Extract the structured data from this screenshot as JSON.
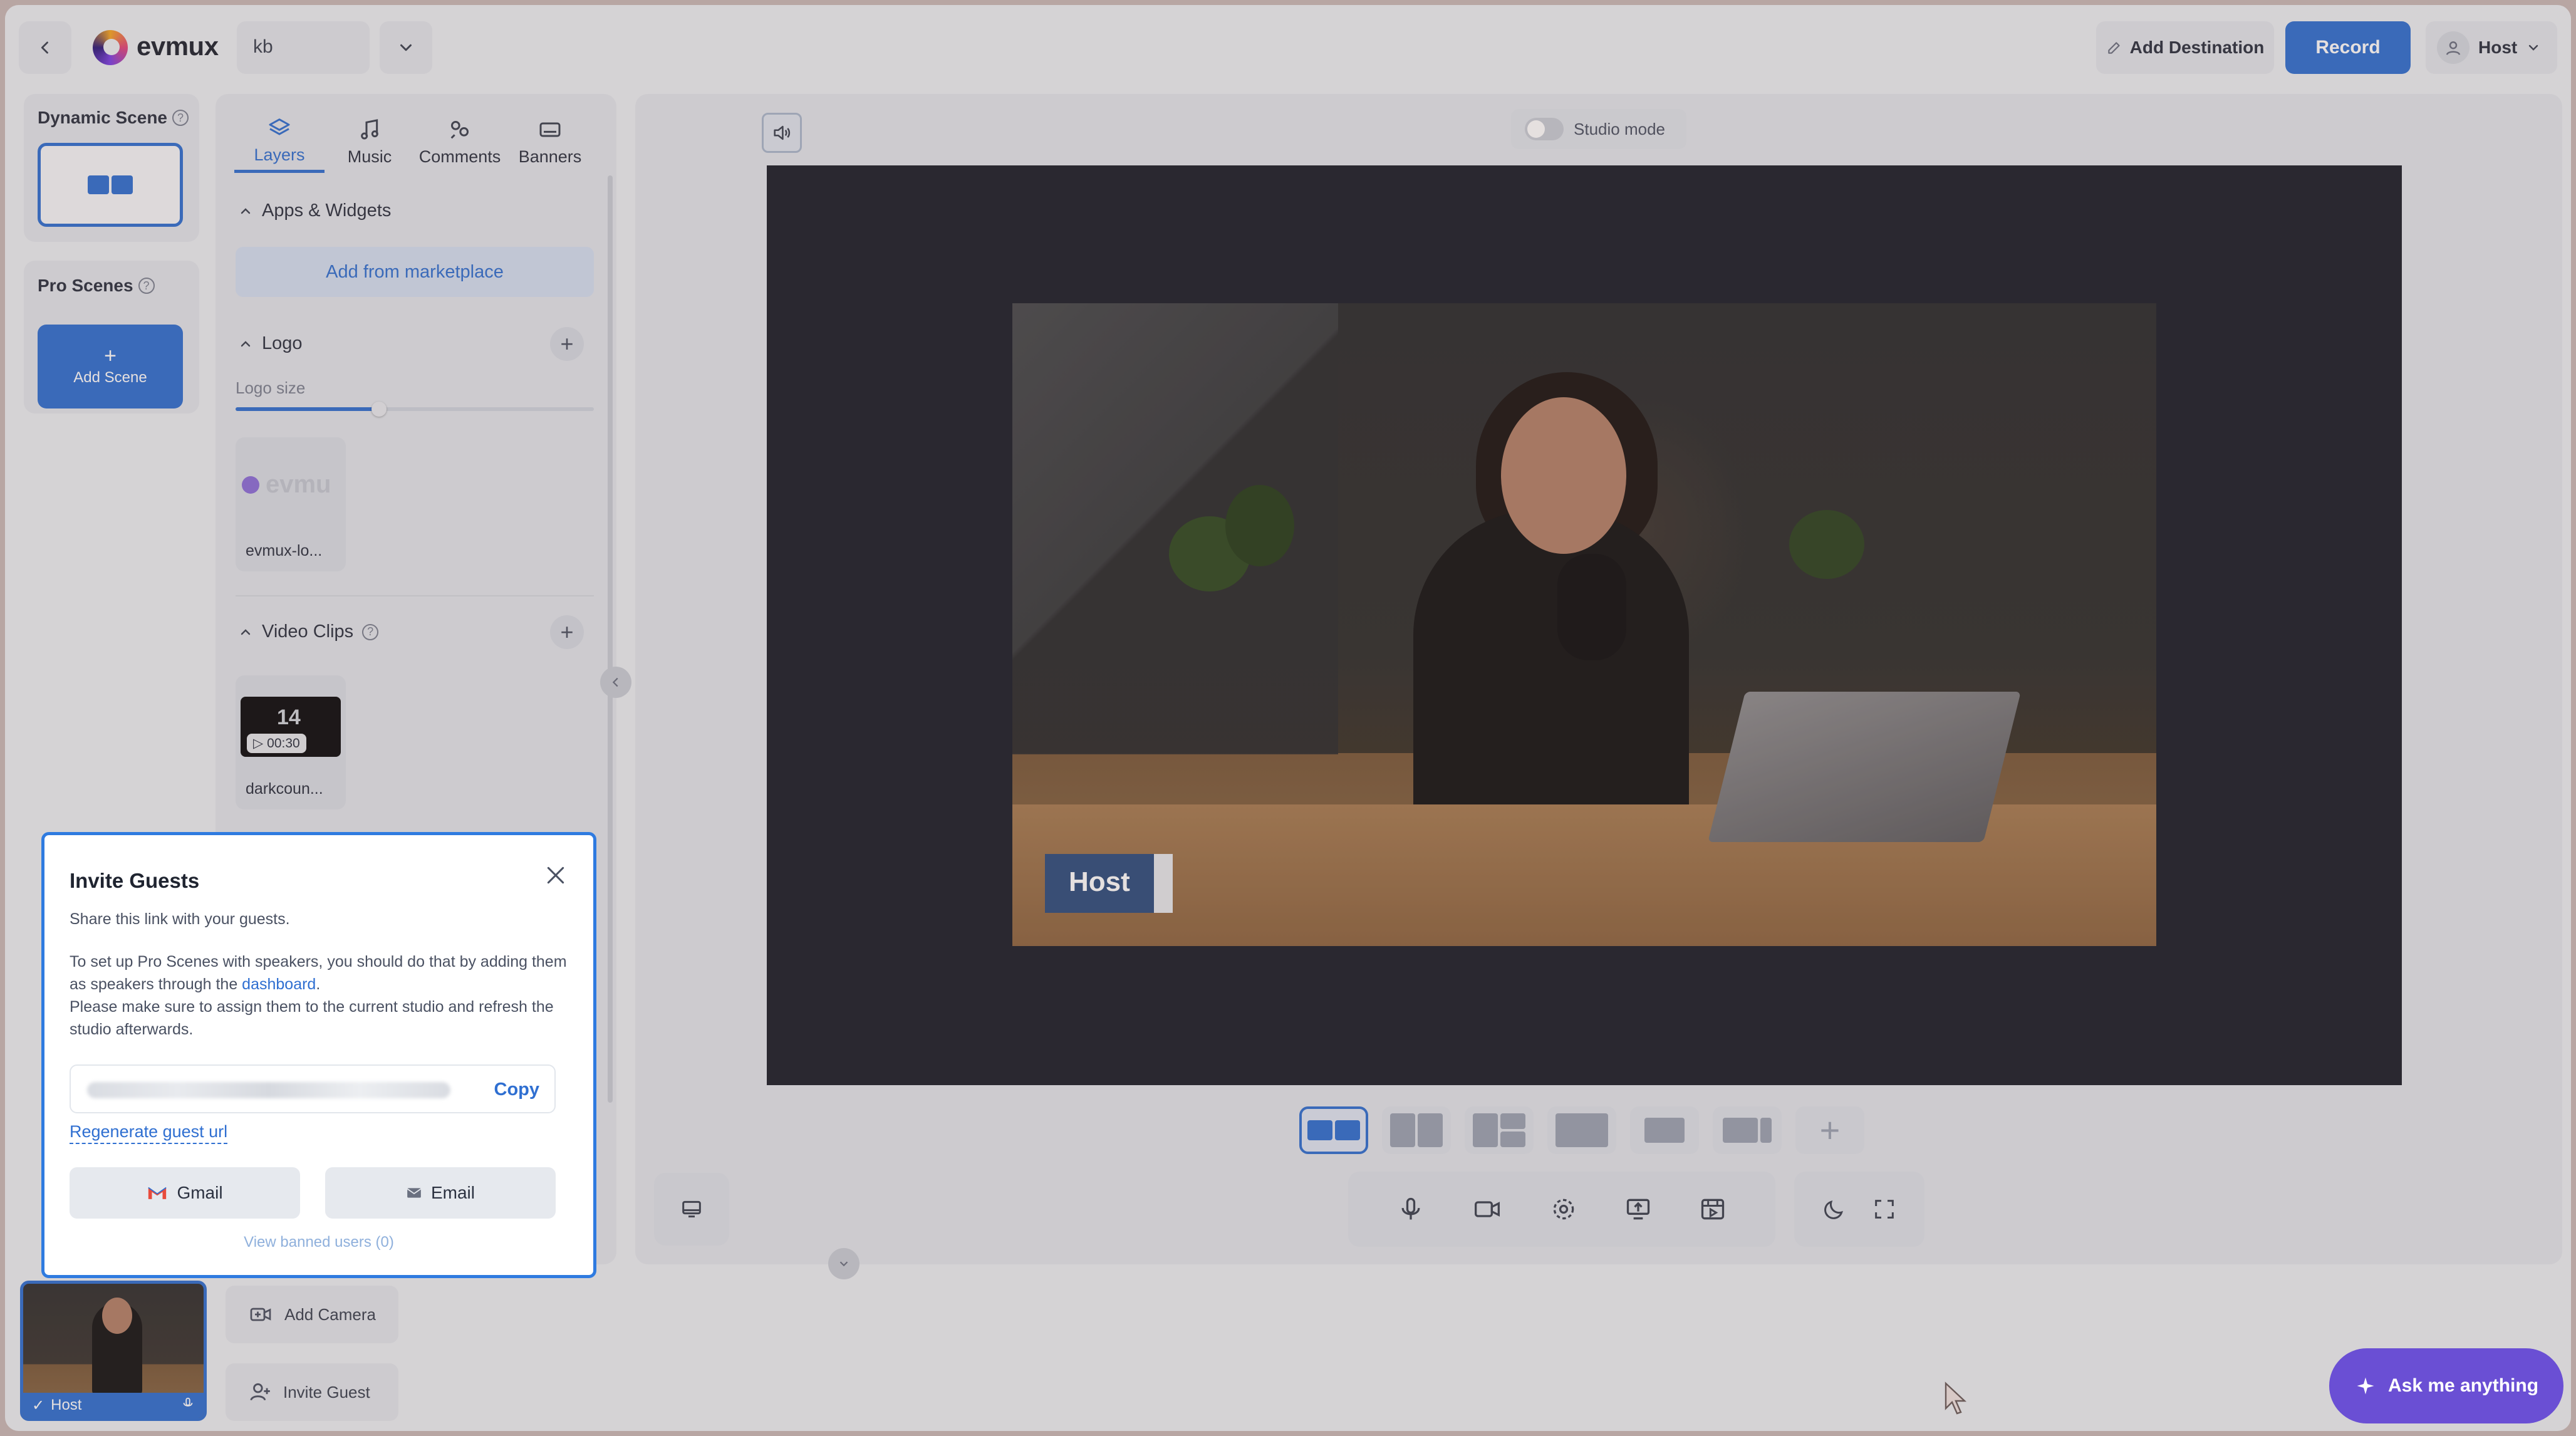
{
  "app": {
    "name": "evmux"
  },
  "header": {
    "studio_name": "kb",
    "add_destination": "Add Destination",
    "record": "Record",
    "user": "Host"
  },
  "scenes": {
    "dynamic_label": "Dynamic Scene",
    "pro_label": "Pro Scenes",
    "add_scene": "Add Scene",
    "help_glyph": "?"
  },
  "panel": {
    "tabs": [
      {
        "label": "Layers",
        "icon": "layers-icon",
        "active": true
      },
      {
        "label": "Music",
        "icon": "music-note-icon"
      },
      {
        "label": "Comments",
        "icon": "comments-icon"
      },
      {
        "label": "Banners",
        "icon": "banner-icon"
      }
    ],
    "apps_widgets": "Apps & Widgets",
    "add_marketplace": "Add from marketplace",
    "logo": "Logo",
    "logo_size": "Logo size",
    "logo_size_value": 0.4,
    "logo_asset": "evmux-lo...",
    "logo_watermark": "evmu",
    "video_clips": "Video Clips",
    "video_asset": "darkcoun...",
    "video_duration": "00:30",
    "video_thumb_text": "14"
  },
  "stage": {
    "studio_mode": "Studio mode",
    "host_label": "Host"
  },
  "invite": {
    "title": "Invite Guests",
    "intro": "Share this link with your guests.",
    "body_pre": "To set up Pro Scenes with speakers, you should do that by adding them as speakers through the ",
    "dashboard_link": "dashboard",
    "body_post": ".",
    "body_line2": "Please make sure to assign them to the current studio and refresh the studio afterwards.",
    "copy": "Copy",
    "regenerate": "Regenerate guest url",
    "gmail": "Gmail",
    "email": "Email",
    "view_banned": "View banned users (0)"
  },
  "bottom": {
    "host_thumb": "Host",
    "add_camera": "Add Camera",
    "invite_guest": "Invite Guest",
    "ask": "Ask me anything"
  },
  "colors": {
    "accent": "#2f6fd1",
    "ask_button": "#6a4fd4",
    "host_tag": "#2e4d7e"
  }
}
